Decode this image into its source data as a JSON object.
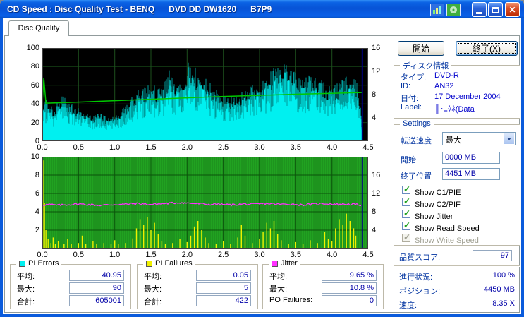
{
  "window": {
    "title": "CD Speed : Disc Quality Test - BENQ      DVD DD DW1620      B7P9"
  },
  "tab": {
    "label": "Disc Quality"
  },
  "buttons": {
    "start": "開始",
    "exit": "終了(X)"
  },
  "disc_info": {
    "title": "ディスク情報",
    "rows": [
      [
        "タイプ:",
        "DVD-R"
      ],
      [
        "ID:",
        "AN32"
      ],
      [
        "日付:",
        "17 December 2004"
      ],
      [
        "Label:",
        "╫･ﾆｸﾈ(Data"
      ]
    ]
  },
  "settings": {
    "title": "Settings",
    "transfer_label": "転送速度",
    "transfer_value": "最大",
    "start_label": "開始",
    "start_value": "0000 MB",
    "end_label": "終了位置",
    "end_value": "4451 MB",
    "checkboxes": [
      {
        "label": "Show C1/PIE",
        "checked": true,
        "disabled": false
      },
      {
        "label": "Show C2/PIF",
        "checked": true,
        "disabled": false
      },
      {
        "label": "Show Jitter",
        "checked": true,
        "disabled": false
      },
      {
        "label": "Show Read Speed",
        "checked": true,
        "disabled": false
      },
      {
        "label": "Show Write Speed",
        "checked": true,
        "disabled": true
      }
    ]
  },
  "quality": {
    "label": "品質スコア:",
    "value": "97"
  },
  "status": {
    "rows": [
      {
        "label": "進行状況:",
        "value": "100 %"
      },
      {
        "label": "ポジション:",
        "value": "4450 MB"
      },
      {
        "label": "速度:",
        "value": "8.35 X"
      }
    ]
  },
  "legend": {
    "boxes": [
      {
        "title": "PI Errors",
        "color": "#00f0f0",
        "rows": [
          [
            "平均:",
            "40.95"
          ],
          [
            "最大:",
            "90"
          ],
          [
            "合計:",
            "605001"
          ]
        ]
      },
      {
        "title": "PI Failures",
        "color": "#f0f000",
        "rows": [
          [
            "平均:",
            "0.05"
          ],
          [
            "最大:",
            "5"
          ],
          [
            "合計:",
            "422"
          ]
        ]
      },
      {
        "title": "Jitter",
        "color": "#ff30ff",
        "rows": [
          [
            "平均:",
            "9.65 %"
          ],
          [
            "最大:",
            "10.8 %"
          ],
          [
            "PO Failures:",
            "0"
          ]
        ]
      }
    ]
  },
  "chart_data": [
    {
      "type": "area",
      "title": "PI Errors / Read Speed",
      "background": "#000000",
      "x_ticks": [
        "0.0",
        "0.5",
        "1.0",
        "1.5",
        "2.0",
        "2.5",
        "3.0",
        "3.5",
        "4.0",
        "4.5"
      ],
      "y_left_ticks": [
        "100",
        "80",
        "60",
        "40",
        "20",
        "0"
      ],
      "y_right_ticks": [
        "16",
        "12",
        "8",
        "4"
      ],
      "ylim_left": [
        0,
        100
      ],
      "ylim_right": [
        0,
        16
      ],
      "xlim": [
        0,
        4.5
      ],
      "series": [
        {
          "name": "PI Errors",
          "color": "#00f0f0",
          "color_dark": "#009c9c",
          "x": [
            0,
            0.05,
            0.1,
            0.15,
            0.2,
            0.25,
            0.3,
            0.35,
            0.4,
            0.45,
            0.5,
            0.6,
            0.7,
            0.8,
            0.9,
            1.0,
            1.1,
            1.2,
            1.3,
            1.4,
            1.5,
            1.6,
            1.7,
            1.75,
            1.8,
            1.85,
            1.9,
            1.95,
            2.0,
            2.05,
            2.1,
            2.2,
            2.3,
            2.4,
            2.5,
            2.6,
            2.7,
            2.8,
            2.9,
            3.0,
            3.1,
            3.2,
            3.3,
            3.35,
            3.4,
            3.5,
            3.6,
            3.7,
            3.8,
            3.9,
            4.0,
            4.1,
            4.2,
            4.3,
            4.35,
            4.4,
            4.42
          ],
          "y": [
            38,
            46,
            40,
            36,
            42,
            47,
            50,
            44,
            40,
            38,
            36,
            32,
            28,
            30,
            26,
            28,
            34,
            44,
            54,
            60,
            62,
            58,
            66,
            80,
            70,
            66,
            74,
            68,
            85,
            88,
            80,
            72,
            64,
            56,
            50,
            48,
            52,
            56,
            60,
            66,
            70,
            80,
            86,
            90,
            80,
            74,
            70,
            72,
            68,
            64,
            60,
            64,
            70,
            74,
            62,
            40,
            0
          ]
        },
        {
          "name": "Read Speed",
          "color": "#00c800",
          "x": [
            0,
            0.02,
            0.05,
            0.5,
            1.0,
            1.5,
            2.0,
            2.5,
            3.0,
            3.5,
            4.0,
            4.3,
            4.42
          ],
          "y": [
            40.5,
            68,
            40.8,
            42,
            43.5,
            45,
            46.5,
            48,
            49.2,
            50.4,
            51.4,
            52,
            52.2
          ]
        },
        {
          "name": "End Marker",
          "color": "#000080",
          "x": [
            4.42
          ]
        }
      ]
    },
    {
      "type": "bar+line",
      "title": "PI Failures / Jitter",
      "background": "#21a221",
      "x_ticks": [
        "0.0",
        "0.5",
        "1.0",
        "1.5",
        "2.0",
        "2.5",
        "3.0",
        "3.5",
        "4.0",
        "4.5"
      ],
      "y_left_ticks": [
        "10",
        "8",
        "6",
        "4",
        "2"
      ],
      "y_right_ticks": [
        "16",
        "12",
        "8",
        "4"
      ],
      "ylim_left": [
        0,
        10
      ],
      "ylim_right": [
        0,
        20
      ],
      "xlim": [
        0,
        4.5
      ],
      "series": [
        {
          "name": "PI Failures",
          "color": "#f0f000",
          "bars": [
            [
              0.02,
              9.6
            ],
            [
              0.03,
              5.0
            ],
            [
              0.05,
              2.0
            ],
            [
              0.08,
              1.0
            ],
            [
              0.12,
              0.6
            ],
            [
              0.15,
              1.2
            ],
            [
              0.18,
              0.5
            ],
            [
              0.22,
              0.8
            ],
            [
              0.3,
              0.5
            ],
            [
              0.35,
              1.0
            ],
            [
              0.4,
              0.5
            ],
            [
              0.5,
              0.6
            ],
            [
              0.55,
              1.4
            ],
            [
              0.6,
              0.5
            ],
            [
              0.7,
              0.8
            ],
            [
              0.75,
              0.5
            ],
            [
              0.85,
              0.6
            ],
            [
              0.95,
              0.5
            ],
            [
              1.0,
              0.9
            ],
            [
              1.05,
              0.5
            ],
            [
              1.15,
              0.6
            ],
            [
              1.25,
              1.1
            ],
            [
              1.3,
              2.2
            ],
            [
              1.35,
              3.2
            ],
            [
              1.4,
              2.6
            ],
            [
              1.45,
              3.4
            ],
            [
              1.5,
              2.0
            ],
            [
              1.55,
              2.8
            ],
            [
              1.6,
              1.6
            ],
            [
              1.65,
              0.8
            ],
            [
              1.7,
              0.5
            ],
            [
              1.8,
              0.6
            ],
            [
              1.9,
              1.0
            ],
            [
              2.0,
              0.7
            ],
            [
              2.05,
              1.4
            ],
            [
              2.1,
              2.4
            ],
            [
              2.15,
              3.0
            ],
            [
              2.2,
              2.0
            ],
            [
              2.25,
              1.2
            ],
            [
              2.3,
              0.6
            ],
            [
              2.4,
              0.5
            ],
            [
              2.5,
              0.8
            ],
            [
              2.6,
              0.5
            ],
            [
              2.7,
              1.2
            ],
            [
              2.75,
              2.6
            ],
            [
              2.8,
              1.4
            ],
            [
              2.9,
              0.6
            ],
            [
              3.0,
              1.0
            ],
            [
              3.05,
              1.8
            ],
            [
              3.1,
              2.8
            ],
            [
              3.15,
              2.2
            ],
            [
              3.2,
              3.0
            ],
            [
              3.25,
              1.6
            ],
            [
              3.3,
              0.9
            ],
            [
              3.4,
              0.5
            ],
            [
              3.5,
              0.7
            ],
            [
              3.6,
              0.5
            ],
            [
              3.7,
              0.9
            ],
            [
              3.8,
              0.6
            ],
            [
              3.9,
              1.8
            ],
            [
              3.95,
              1.0
            ],
            [
              4.0,
              0.8
            ],
            [
              4.05,
              2.2
            ],
            [
              4.1,
              3.2
            ],
            [
              4.15,
              2.6
            ],
            [
              4.2,
              3.8
            ],
            [
              4.25,
              3.0
            ],
            [
              4.3,
              2.2
            ],
            [
              4.33,
              1.4
            ]
          ]
        },
        {
          "name": "Jitter",
          "color": "#ff30ff",
          "x": [
            0,
            0.1,
            0.2,
            0.3,
            0.4,
            0.5,
            0.6,
            0.7,
            0.8,
            0.9,
            1.0,
            1.1,
            1.2,
            1.3,
            1.4,
            1.5,
            1.6,
            1.7,
            1.8,
            1.9,
            2.0,
            2.1,
            2.2,
            2.3,
            2.4,
            2.5,
            2.6,
            2.7,
            2.8,
            2.9,
            3.0,
            3.1,
            3.2,
            3.3,
            3.4,
            3.5,
            3.6,
            3.7,
            3.8,
            3.9,
            4.0,
            4.1,
            4.2,
            4.3,
            4.4
          ],
          "y": [
            4.75,
            4.8,
            4.7,
            4.75,
            4.8,
            4.85,
            4.8,
            4.75,
            4.7,
            4.75,
            4.8,
            4.8,
            4.85,
            4.9,
            4.85,
            4.8,
            4.85,
            4.9,
            4.95,
            5.0,
            4.95,
            4.9,
            4.85,
            4.8,
            4.85,
            4.8,
            4.75,
            4.8,
            4.85,
            4.8,
            4.85,
            4.9,
            4.85,
            4.8,
            4.85,
            4.8,
            4.75,
            4.8,
            4.85,
            4.9,
            4.85,
            4.8,
            4.85,
            4.8,
            4.75
          ]
        },
        {
          "name": "End Marker",
          "color": "#000080",
          "x": [
            4.42
          ]
        }
      ]
    }
  ]
}
